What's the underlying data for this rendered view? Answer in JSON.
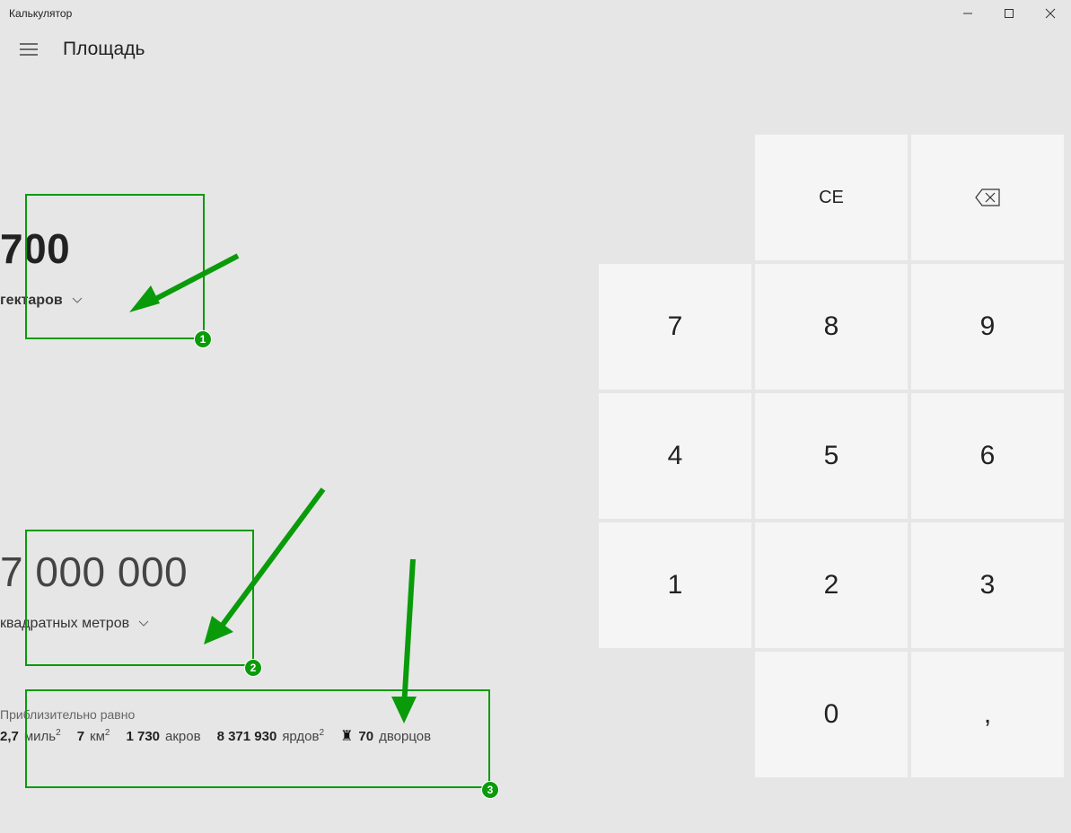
{
  "window": {
    "title": "Калькулятор"
  },
  "header": {
    "mode": "Площадь"
  },
  "input": {
    "value": "700",
    "unit_label": "гектаров"
  },
  "output": {
    "value": "7 000 000",
    "unit_label": "квадратных метров"
  },
  "approx": {
    "label": "Приблизительно равно",
    "items": [
      {
        "num": "2,7",
        "unit": "миль",
        "sup": "2"
      },
      {
        "num": "7",
        "unit": "км",
        "sup": "2"
      },
      {
        "num": "1 730",
        "unit": "акров",
        "sup": ""
      },
      {
        "num": "8 371 930",
        "unit": "ярдов",
        "sup": "2"
      },
      {
        "num": "70",
        "unit": "дворцов",
        "sup": "",
        "icon": "castle"
      }
    ]
  },
  "keypad": {
    "ce": "CE",
    "keys": [
      "7",
      "8",
      "9",
      "4",
      "5",
      "6",
      "1",
      "2",
      "3",
      "0",
      ","
    ]
  },
  "annotations": {
    "badge1": "1",
    "badge2": "2",
    "badge3": "3"
  }
}
